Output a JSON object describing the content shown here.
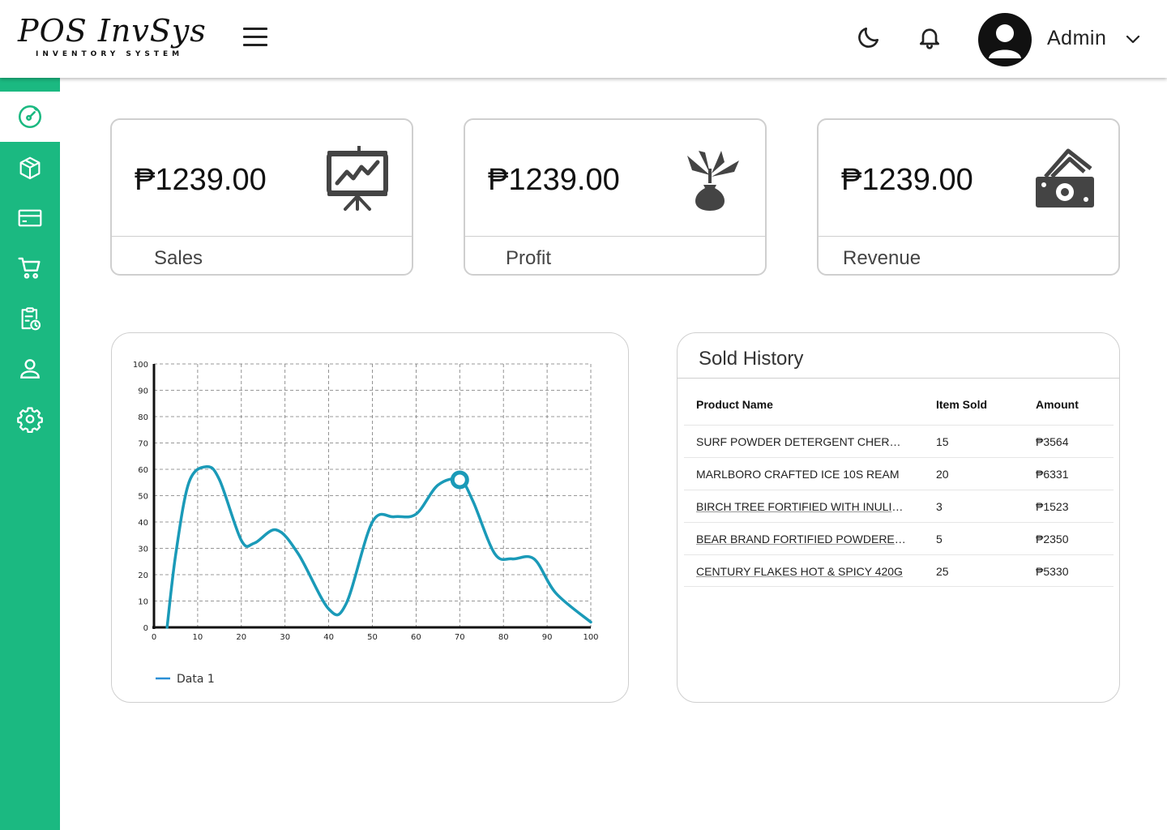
{
  "app": {
    "logo_main": "POS InvSys",
    "logo_sub": "INVENTORY SYSTEM"
  },
  "header": {
    "user_name": "Admin",
    "icons": [
      "menu-icon",
      "moon-icon",
      "bell-icon",
      "user-avatar-icon",
      "chevron-down-icon"
    ]
  },
  "sidebar": {
    "items": [
      {
        "icon": "dashboard-gauge-icon",
        "active": true
      },
      {
        "icon": "box-icon",
        "active": false
      },
      {
        "icon": "credit-card-icon",
        "active": false
      },
      {
        "icon": "cart-icon",
        "active": false
      },
      {
        "icon": "clipboard-clock-icon",
        "active": false
      },
      {
        "icon": "user-icon",
        "active": false
      },
      {
        "icon": "gear-icon",
        "active": false
      }
    ],
    "color": "#1bb981"
  },
  "stats": [
    {
      "amount": "₱1239.00",
      "label": "Sales",
      "icon": "presentation-chart-icon"
    },
    {
      "amount": "₱1239.00",
      "label": "Profit",
      "icon": "money-plant-icon"
    },
    {
      "amount": "₱1239.00",
      "label": "Revenue",
      "icon": "cash-icon"
    }
  ],
  "chart_data": {
    "type": "line",
    "xlim": [
      0,
      100
    ],
    "ylim": [
      0,
      100
    ],
    "x_ticks": [
      "0",
      "10",
      "20",
      "30",
      "40",
      "50",
      "60",
      "70",
      "80",
      "90",
      "100"
    ],
    "y_ticks": [
      "100",
      "90",
      "80",
      "70",
      "60",
      "50",
      "40",
      "30",
      "20",
      "10",
      "0"
    ],
    "grid": true,
    "legend": "bottom-left",
    "series": [
      {
        "name": "Data 1",
        "color": "#1a9ab8",
        "x": [
          3,
          5,
          8,
          12,
          15,
          20,
          23,
          28,
          33,
          40,
          44,
          50,
          55,
          60,
          65,
          70,
          73,
          78,
          82,
          87,
          92,
          100
        ],
        "y": [
          0,
          28,
          55,
          61,
          56,
          33,
          32,
          37,
          28,
          7,
          9,
          40,
          42,
          43,
          54,
          56,
          48,
          28,
          26,
          26,
          13,
          2
        ]
      }
    ],
    "highlight_point": {
      "x": 70,
      "y": 56
    }
  },
  "sold_history": {
    "title": "Sold History",
    "columns": [
      "Product Name",
      "Item Sold",
      "Amount"
    ],
    "rows": [
      {
        "name": "SURF POWDER DETERGENT CHERRY...",
        "sold": "15",
        "amount": "₱3564",
        "link": false
      },
      {
        "name": "MARLBORO CRAFTED ICE 10S REAM",
        "sold": "20",
        "amount": "₱6331",
        "link": false
      },
      {
        "name": "BIRCH TREE FORTIFIED WITH INULIN...",
        "sold": "3",
        "amount": "₱1523",
        "link": true
      },
      {
        "name": "BEAR BRAND FORTIFIED POWDERED...",
        "sold": "5",
        "amount": "₱2350",
        "link": true
      },
      {
        "name": "CENTURY FLAKES HOT & SPICY 420G",
        "sold": "25",
        "amount": "₱5330",
        "link": true
      }
    ]
  }
}
